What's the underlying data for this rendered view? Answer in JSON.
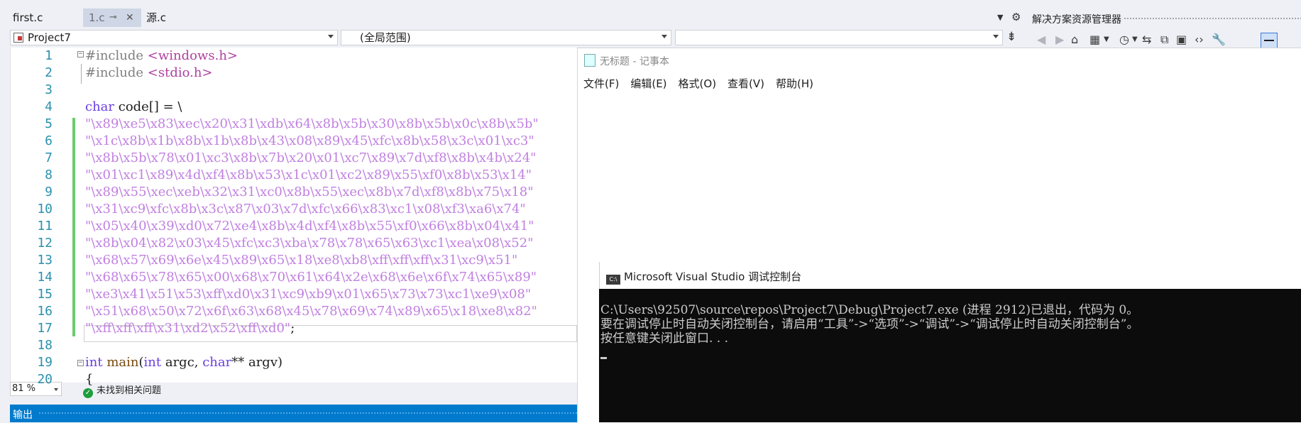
{
  "tabs": [
    {
      "label": "first.c"
    },
    {
      "label": "1.c",
      "pin": "⊸",
      "close": "✕"
    },
    {
      "label": "源.c"
    }
  ],
  "nav": {
    "project": "Project7",
    "scope": "(全局范围)",
    "member": ""
  },
  "solution_explorer": {
    "title": "解决方案资源管理器"
  },
  "editor": {
    "lines": [
      {
        "n": "1",
        "parts": [
          {
            "t": "#include ",
            "c": "pp"
          },
          {
            "t": "<windows.h>",
            "c": "inc"
          }
        ]
      },
      {
        "n": "2",
        "parts": [
          {
            "t": "#include ",
            "c": "pp"
          },
          {
            "t": "<stdio.h>",
            "c": "inc"
          }
        ]
      },
      {
        "n": "3",
        "parts": []
      },
      {
        "n": "4",
        "parts": [
          {
            "t": "char",
            "c": "kw"
          },
          {
            "t": " code[] = \\",
            "c": "pl"
          }
        ]
      },
      {
        "n": "5",
        "parts": [
          {
            "t": "\"\\x89\\xe5\\x83\\xec\\x20\\x31\\xdb\\x64\\x8b\\x5b\\x30\\x8b\\x5b\\x0c\\x8b\\x5b\"",
            "c": "str"
          }
        ]
      },
      {
        "n": "6",
        "parts": [
          {
            "t": "\"\\x1c\\x8b\\x1b\\x8b\\x1b\\x8b\\x43\\x08\\x89\\x45\\xfc\\x8b\\x58\\x3c\\x01\\xc3\"",
            "c": "str"
          }
        ]
      },
      {
        "n": "7",
        "parts": [
          {
            "t": "\"\\x8b\\x5b\\x78\\x01\\xc3\\x8b\\x7b\\x20\\x01\\xc7\\x89\\x7d\\xf8\\x8b\\x4b\\x24\"",
            "c": "str"
          }
        ]
      },
      {
        "n": "8",
        "parts": [
          {
            "t": "\"\\x01\\xc1\\x89\\x4d\\xf4\\x8b\\x53\\x1c\\x01\\xc2\\x89\\x55\\xf0\\x8b\\x53\\x14\"",
            "c": "str"
          }
        ]
      },
      {
        "n": "9",
        "parts": [
          {
            "t": "\"\\x89\\x55\\xec\\xeb\\x32\\x31\\xc0\\x8b\\x55\\xec\\x8b\\x7d\\xf8\\x8b\\x75\\x18\"",
            "c": "str"
          }
        ]
      },
      {
        "n": "10",
        "parts": [
          {
            "t": "\"\\x31\\xc9\\xfc\\x8b\\x3c\\x87\\x03\\x7d\\xfc\\x66\\x83\\xc1\\x08\\xf3\\xa6\\x74\"",
            "c": "str"
          }
        ]
      },
      {
        "n": "11",
        "parts": [
          {
            "t": "\"\\x05\\x40\\x39\\xd0\\x72\\xe4\\x8b\\x4d\\xf4\\x8b\\x55\\xf0\\x66\\x8b\\x04\\x41\"",
            "c": "str"
          }
        ]
      },
      {
        "n": "12",
        "parts": [
          {
            "t": "\"\\x8b\\x04\\x82\\x03\\x45\\xfc\\xc3\\xba\\x78\\x78\\x65\\x63\\xc1\\xea\\x08\\x52\"",
            "c": "str"
          }
        ]
      },
      {
        "n": "13",
        "parts": [
          {
            "t": "\"\\x68\\x57\\x69\\x6e\\x45\\x89\\x65\\x18\\xe8\\xb8\\xff\\xff\\xff\\x31\\xc9\\x51\"",
            "c": "str"
          }
        ]
      },
      {
        "n": "14",
        "parts": [
          {
            "t": "\"\\x68\\x65\\x78\\x65\\x00\\x68\\x70\\x61\\x64\\x2e\\x68\\x6e\\x6f\\x74\\x65\\x89\"",
            "c": "str"
          }
        ]
      },
      {
        "n": "15",
        "parts": [
          {
            "t": "\"\\xe3\\x41\\x51\\x53\\xff\\xd0\\x31\\xc9\\xb9\\x01\\x65\\x73\\x73\\xc1\\xe9\\x08\"",
            "c": "str"
          }
        ]
      },
      {
        "n": "16",
        "parts": [
          {
            "t": "\"\\x51\\x68\\x50\\x72\\x6f\\x63\\x68\\x45\\x78\\x69\\x74\\x89\\x65\\x18\\xe8\\x82\"",
            "c": "str"
          }
        ]
      },
      {
        "n": "17",
        "parts": [
          {
            "t": "\"\\xff\\xff\\xff\\x31\\xd2\\x52\\xff\\xd0\"",
            "c": "str"
          },
          {
            "t": ";",
            "c": "pl"
          }
        ]
      },
      {
        "n": "18",
        "parts": []
      },
      {
        "n": "19",
        "parts": [
          {
            "t": "int",
            "c": "kw"
          },
          {
            "t": " ",
            "c": "pl"
          },
          {
            "t": "main",
            "c": "fn"
          },
          {
            "t": "(",
            "c": "pl"
          },
          {
            "t": "int",
            "c": "kw"
          },
          {
            "t": " argc, ",
            "c": "pl"
          },
          {
            "t": "char",
            "c": "kw"
          },
          {
            "t": "** argv)",
            "c": "pl"
          }
        ]
      },
      {
        "n": "20",
        "parts": [
          {
            "t": "{",
            "c": "pl"
          }
        ]
      }
    ],
    "zoom": "81 %",
    "issues": "未找到相关问题",
    "issues_icon": "✓",
    "output_label": "输出"
  },
  "notepad": {
    "title": "无标题 - 记事本",
    "menu": [
      "文件(F)",
      "编辑(E)",
      "格式(O)",
      "查看(V)",
      "帮助(H)"
    ]
  },
  "console": {
    "title": "Microsoft Visual Studio 调试控制台",
    "icon_text": "C:\\",
    "lines": [
      "C:\\Users\\92507\\source\\repos\\Project7\\Debug\\Project7.exe (进程 2912)已退出，代码为 0。",
      "要在调试停止时自动关闭控制台，请启用“工具”->“选项”->“调试”->“调试停止时自动关闭控制台”。",
      "按任意键关闭此窗口. . ."
    ]
  }
}
